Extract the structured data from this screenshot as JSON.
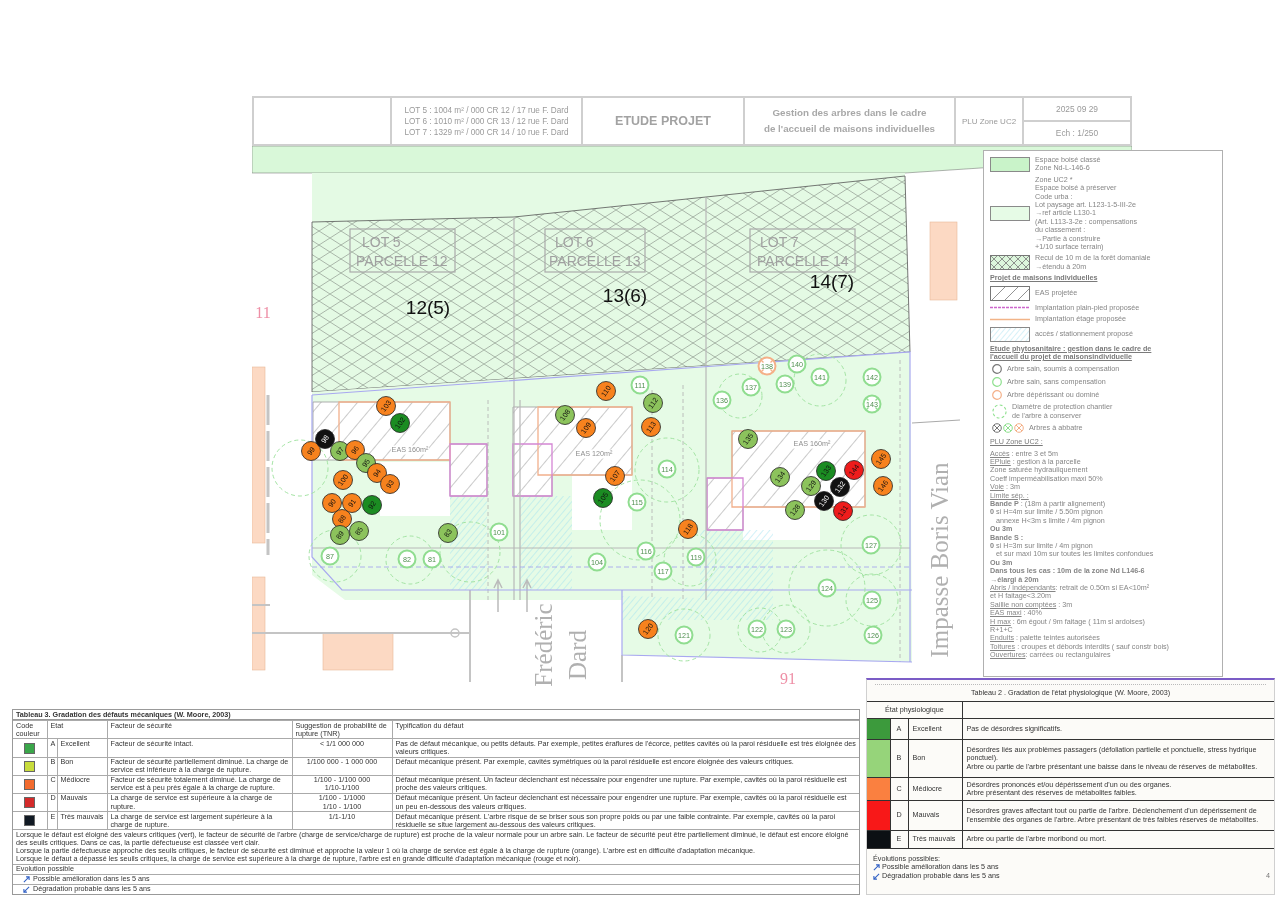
{
  "title_block": {
    "lots": [
      "LOT 5 : 1004 m² / 000 CR 12 / 17 rue F. Dard",
      "LOT 6 : 1010 m² / 000 CR 13 / 12 rue F. Dard",
      "LOT 7 : 1329 m² / 000 CR 14 / 10 rue F. Dard"
    ],
    "stage": "ETUDE PROJET",
    "subject": [
      "Gestion des arbres dans le cadre",
      "de l'accueil de maisons individuelles"
    ],
    "zone": "PLU Zone UC2",
    "date": "2025 09 29",
    "scale": "Ech : 1/250"
  },
  "map": {
    "lots": [
      {
        "lot": "LOT 5",
        "parcel": "PARCELLE 12",
        "number": "12(5)"
      },
      {
        "lot": "LOT 6",
        "parcel": "PARCELLE 13",
        "number": "13(6)"
      },
      {
        "lot": "LOT 7",
        "parcel": "PARCELLE 14",
        "number": "14(7)"
      }
    ],
    "buildings": [
      {
        "label": "EAS 160m²"
      },
      {
        "label": "EAS 120m²"
      },
      {
        "label": "EAS 160m²"
      }
    ],
    "plot_numbers": [
      "11",
      "91"
    ],
    "street_names": [
      "Frédéric",
      "Dard",
      "Impasse Boris Vian"
    ],
    "existing_trees": [
      {
        "number": "111",
        "color": "#90dd90",
        "felling": false
      },
      {
        "number": "114",
        "color": "#90dd90",
        "felling": false
      },
      {
        "number": "115",
        "color": "#90dd90",
        "felling": false
      },
      {
        "number": "116",
        "color": "#90dd90",
        "felling": false
      },
      {
        "number": "117",
        "color": "#90dd90",
        "felling": false
      },
      {
        "number": "119",
        "color": "#90dd90",
        "felling": false
      },
      {
        "number": "104",
        "color": "#90dd90",
        "felling": false
      },
      {
        "number": "101",
        "color": "#90dd90",
        "felling": false
      },
      {
        "number": "82",
        "color": "#90dd90",
        "felling": false
      },
      {
        "number": "81",
        "color": "#90dd90",
        "felling": false
      },
      {
        "number": "87",
        "color": "#90dd90",
        "felling": false
      },
      {
        "number": "121",
        "color": "#90dd90",
        "felling": false
      },
      {
        "number": "136",
        "color": "#90dd90",
        "felling": false
      },
      {
        "number": "137",
        "color": "#90dd90",
        "felling": false
      },
      {
        "number": "138",
        "color": "#f4b088",
        "felling": true
      },
      {
        "number": "139",
        "color": "#90dd90",
        "felling": false
      },
      {
        "number": "140",
        "color": "#90dd90",
        "felling": false
      },
      {
        "number": "141",
        "color": "#90dd90",
        "felling": false
      },
      {
        "number": "142",
        "color": "#90dd90",
        "felling": false
      },
      {
        "number": "143",
        "color": "#90dd90",
        "felling": true
      },
      {
        "number": "127",
        "color": "#90dd90",
        "felling": false
      },
      {
        "number": "124",
        "color": "#90dd90",
        "felling": false
      },
      {
        "number": "125",
        "color": "#90dd90",
        "felling": false
      },
      {
        "number": "122",
        "color": "#90dd90",
        "felling": false
      },
      {
        "number": "123",
        "color": "#90dd90",
        "felling": false
      },
      {
        "number": "126",
        "color": "#90dd90",
        "felling": false
      }
    ],
    "trees": [
      {
        "number": "103",
        "color": "#f7821e"
      },
      {
        "number": "102",
        "color": "#1b8c22"
      },
      {
        "number": "99",
        "color": "#f7821e"
      },
      {
        "number": "98",
        "color": "#111111"
      },
      {
        "number": "97",
        "color": "#8cc35c"
      },
      {
        "number": "96",
        "color": "#f7821e"
      },
      {
        "number": "95",
        "color": "#8cc35c"
      },
      {
        "number": "94",
        "color": "#f7821e"
      },
      {
        "number": "93",
        "color": "#f7821e"
      },
      {
        "number": "100",
        "color": "#f7821e"
      },
      {
        "number": "90",
        "color": "#f7821e"
      },
      {
        "number": "91",
        "color": "#f7821e"
      },
      {
        "number": "92",
        "color": "#1b8c22"
      },
      {
        "number": "88",
        "color": "#f7821e"
      },
      {
        "number": "89",
        "color": "#8cc35c"
      },
      {
        "number": "85",
        "color": "#8cc35c"
      },
      {
        "number": "83",
        "color": "#8cc35c"
      },
      {
        "number": "110",
        "color": "#f7821e"
      },
      {
        "number": "108",
        "color": "#8cc35c"
      },
      {
        "number": "109",
        "color": "#f7821e"
      },
      {
        "number": "112",
        "color": "#8cc35c"
      },
      {
        "number": "113",
        "color": "#f7821e"
      },
      {
        "number": "107",
        "color": "#f7821e"
      },
      {
        "number": "105",
        "color": "#1b8c22"
      },
      {
        "number": "118",
        "color": "#f7821e"
      },
      {
        "number": "120",
        "color": "#f7821e"
      },
      {
        "number": "135",
        "color": "#8cc35c"
      },
      {
        "number": "134",
        "color": "#8cc35c"
      },
      {
        "number": "133",
        "color": "#1b8c22"
      },
      {
        "number": "144",
        "color": "#ee1c1c"
      },
      {
        "number": "145",
        "color": "#f7821e"
      },
      {
        "number": "146",
        "color": "#f7821e"
      },
      {
        "number": "129",
        "color": "#8cc35c"
      },
      {
        "number": "130",
        "color": "#111111"
      },
      {
        "number": "132",
        "color": "#111111"
      },
      {
        "number": "131",
        "color": "#ee1c1c"
      },
      {
        "number": "128",
        "color": "#8cc35c"
      }
    ]
  },
  "legend": {
    "items": [
      {
        "kind": "woodland",
        "lines": [
          "Espace boisé classé",
          "Zone Nd-L-146-6"
        ]
      },
      {
        "kind": "preserved",
        "lines": [
          "Zone UC2 *",
          "Espace boisé à préserver",
          "Code urba :",
          "Lot paysage art. L123-1-5-III-2e",
          "→ref article L130-1",
          "(Art. L113-3-2e : compensations",
          "du classement :",
          "→Partie à construire",
          "+1/10 surface terrain)"
        ]
      },
      {
        "kind": "setback",
        "lines": [
          "Recul de 10 m de la forêt domaniale",
          "→étendu à 20m"
        ]
      },
      {
        "kind": "heading",
        "lines": [
          "Projet de maisons individuelles"
        ]
      },
      {
        "kind": "footprint",
        "lines": [
          "EAS projetée"
        ]
      },
      {
        "kind": "ground_floor",
        "lines": [
          "Implantation plain-pied proposée"
        ]
      },
      {
        "kind": "upper_floor",
        "lines": [
          "Implantation étage proposée"
        ]
      },
      {
        "kind": "parking",
        "lines": [
          "accès / stationnement proposé"
        ]
      },
      {
        "kind": "heading",
        "lines": [
          "Etude phytosanitaire : gestion dans le cadre de",
          "l'accueil du projet de maisonsindividuelle"
        ]
      },
      {
        "kind": "tree_compensated",
        "lines": [
          "Arbre sain, soumis à compensation"
        ]
      },
      {
        "kind": "tree_healthy",
        "lines": [
          "Arbre sain, sans compensation"
        ]
      },
      {
        "kind": "tree_declining",
        "lines": [
          "Arbre dépérissant ou dominé"
        ]
      },
      {
        "kind": "protection",
        "lines": [
          "Diamètre de protection chantier",
          "de l'arbre à conserver"
        ]
      },
      {
        "kind": "felling",
        "lines": [
          "Arbres à abbatre"
        ]
      }
    ],
    "plu": {
      "title": "PLU Zone UC2 :",
      "rules": [
        {
          "kind": "plain",
          "term": "Accès",
          "text": " : entre 3 et 5m"
        },
        {
          "kind": "plain",
          "term": "EPluie",
          "text": " : gestion à la parcelle"
        },
        {
          "kind": "plain",
          "text": "Zone saturée hydrauliquement"
        },
        {
          "kind": "plain",
          "text": "Coeff imperméabilisation maxi 50%"
        },
        {
          "kind": "plain",
          "term": "Voie",
          "text": " : 3m"
        },
        {
          "kind": "plain",
          "term": "Limite sép. :"
        },
        {
          "kind": "plain",
          "text": "**Bande P** : (18m à partir alignement)"
        },
        {
          "kind": "plain",
          "text": "**0** si H=4m sur limite / 5.50m pignon"
        },
        {
          "kind": "indent",
          "text": "annexe H<3m s limite / 4m pignon"
        },
        {
          "kind": "bold",
          "text": "Ou 3m"
        },
        {
          "kind": "bold",
          "text": "Bande S :"
        },
        {
          "kind": "plain",
          "text": "**0** si H=3m sur limite / 4m pignon"
        },
        {
          "kind": "indent",
          "text": "et sur maxi 10m sur toutes les limites confondues"
        },
        {
          "kind": "bold",
          "text": "Ou 3m"
        },
        {
          "kind": "bold",
          "text": "Dans tous les cas : 10m de la zone Nd L146-6"
        },
        {
          "kind": "bold",
          "text": "→élargi à 20m"
        },
        {
          "kind": "plain",
          "term": "Abris / indépendants",
          "text": ": retrait de 0.50m si EA<10m²"
        },
        {
          "kind": "plain",
          "text": "et H faitage<3.20m"
        },
        {
          "kind": "plain",
          "term": "Saillie non comptées",
          "text": " : 3m"
        },
        {
          "kind": "plain",
          "term": "EAS maxi",
          "text": " : 40%"
        },
        {
          "kind": "plain",
          "term": "H max",
          "text": " : 6m égout / 9m faitage ( 11m si ardoises)"
        },
        {
          "kind": "plain",
          "text": "R+1+C"
        },
        {
          "kind": "plain",
          "term": "Enduits",
          "text": " : palette teintes autorisées"
        },
        {
          "kind": "plain",
          "term": "Toitures",
          "text": " : croupes et débords interdits ( sauf constr bois)"
        },
        {
          "kind": "plain",
          "term": "Ouvertures",
          "text": ": carrées ou rectangulaires"
        }
      ]
    }
  },
  "table3": {
    "title": "Tableau 3. Gradation des défauts mécaniques (W. Moore, 2003)",
    "columns": [
      "Code couleur",
      "Etat",
      "Facteur de sécurité",
      "Suggestion de probabilité de rupture (TNR)",
      "Typification du défaut"
    ],
    "rows": [
      {
        "color": "#3aa64a",
        "grade": "A",
        "state": "Excellent",
        "safety": "Facteur de sécurité intact.",
        "probability": [
          "< 1/1 000 000"
        ],
        "defect": "Pas de défaut mécanique, ou petits défauts. Par exemple, petites éraflures de l'écorce, petites cavités où la paroi résiduelle est très éloignée des valeurs critiques."
      },
      {
        "color": "#c8dc3c",
        "grade": "B",
        "state": "Bon",
        "safety": "Facteur de sécurité partiellement diminué. La charge de service est inférieure à la charge de rupture.",
        "probability": [
          "1/100 000 - 1 000 000"
        ],
        "defect": "Défaut mécanique présent. Par exemple, cavités symétriques où la paroi résiduelle est encore éloignée des valeurs critiques."
      },
      {
        "color": "#f26b2e",
        "grade": "C",
        "state": "Médiocre",
        "safety": "Facteur de sécurité totalement diminué. La charge de service est à peu près égale à la charge de rupture.",
        "probability": [
          "1/100 - 1/100 000",
          "1/10-1/100"
        ],
        "defect": "Défaut mécanique présent. Un facteur déclenchant est nécessaire pour engendrer une rupture. Par exemple, cavités où la paroi résiduelle est proche des valeurs critiques."
      },
      {
        "color": "#d42a2a",
        "grade": "D",
        "state": "Mauvais",
        "safety": "La charge de service est supérieure à la charge de rupture.",
        "probability": [
          "1/100 - 1/1000",
          "1/10 - 1/100"
        ],
        "defect": "Défaut mécanique présent. Un facteur déclenchant est nécessaire pour engendrer une rupture. Par exemple, cavités où la paroi résiduelle est un peu en-dessous des valeurs critiques."
      },
      {
        "color": "#111a24",
        "grade": "E",
        "state": "Très mauvais",
        "safety": "La charge de service est largement supérieure à la charge de rupture.",
        "probability": [
          "1/1-1/10"
        ],
        "defect": "Défaut mécanique présent. L'arbre risque de se briser sous son propre poids ou par une faible contrainte. Par exemple, cavités où la paroi résiduelle se situe largement au-dessous des valeurs critiques."
      }
    ],
    "notes": [
      "Lorsque le défaut est éloigné des valeurs critiques (vert), le facteur de sécurité de l'arbre (charge de service/charge de rupture) est proche de la valeur normale pour un arbre sain. Le facteur de sécurité peut être partiellement diminué, le défaut est encore éloigné des seuils critiques. Dans ce cas, la partie défectueuse est classée vert clair.",
      "Lorsque la partie défectueuse approche des seuils critiques, le facteur de sécurité est diminué et approche la valeur 1 où la charge de service est égale à la charge de rupture (orange). L'arbre est en difficulté d'adaptation mécanique.",
      "Lorsque le défaut a dépassé les seuils critiques, la charge de service est supérieure à la charge de rupture, l'arbre est en grande difficulté d'adaptation mécanique (rouge et noir)."
    ],
    "evolution_title": "Evolution possible",
    "evolutions": [
      {
        "kind": "improve",
        "text": "Possible amélioration dans les 5 ans"
      },
      {
        "kind": "degrade",
        "text": "Dégradation probable dans les 5 ans"
      }
    ]
  },
  "table2": {
    "title": "Tableau 2 . Gradation de l'état physiologique (W. Moore, 2003)",
    "header": "État physiologique",
    "rows": [
      {
        "color": "#3c9a3c",
        "grade": "A",
        "state": "Excellent",
        "description": [
          "Pas de désordres significatifs."
        ]
      },
      {
        "color": "#96d47a",
        "grade": "B",
        "state": "Bon",
        "description": [
          "Désordres liés aux problèmes passagers (défoliation partielle et ponctuelle, stress hydrique ponctuel).",
          "Arbre ou partie de l'arbre présentant une baisse dans le niveau de réserves de métabolites."
        ]
      },
      {
        "color": "#fa8040",
        "grade": "C",
        "state": "Médiocre",
        "description": [
          "Désordres prononcés et/ou dépérissement d'un ou des organes.",
          "Arbre présentant des réserves de métabolites faibles."
        ]
      },
      {
        "color": "#f81818",
        "grade": "D",
        "state": "Mauvais",
        "description": [
          "Désordres graves affectant tout ou partie de l'arbre. Déclenchement d'un dépérissement de l'ensemble des organes de l'arbre. Arbre présentant de très faibles réserves de métabolites."
        ]
      },
      {
        "color": "#0c1014",
        "grade": "E",
        "state": "Très mauvais",
        "description": [
          "Arbre ou partie de l'arbre moribond ou mort."
        ]
      }
    ],
    "evolution_title": "Évolutions possibles:",
    "evolutions": [
      {
        "kind": "improve",
        "text": "Possible amélioration dans les 5 ans"
      },
      {
        "kind": "degrade",
        "text": "Dégradation probable dans les 5 ans"
      }
    ],
    "page_number": "4"
  }
}
